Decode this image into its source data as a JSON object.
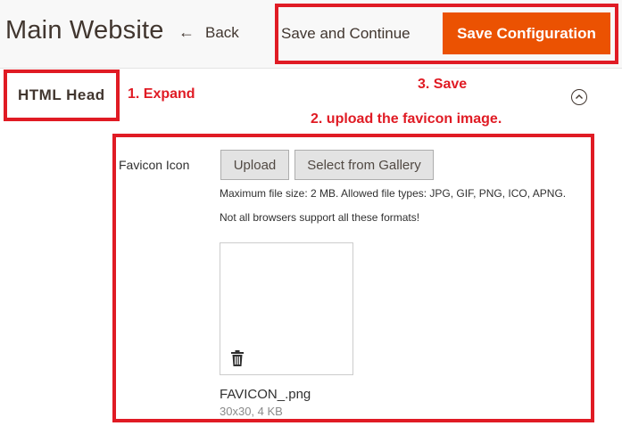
{
  "header": {
    "title": "Main Website",
    "back_label": "Back",
    "save_continue_label": "Save and Continue",
    "save_config_label": "Save Configuration"
  },
  "section": {
    "title": "HTML Head"
  },
  "annotations": {
    "expand": "1. Expand",
    "save": "3. Save",
    "upload": "2. upload the favicon image."
  },
  "favicon": {
    "label": "Favicon Icon",
    "upload_label": "Upload",
    "gallery_label": "Select from Gallery",
    "note_1": "Maximum file size: 2 MB. Allowed file types: JPG, GIF, PNG, ICO, APNG.",
    "note_2": "Not all browsers support all these formats!",
    "file_name": "FAVICON_.png",
    "file_meta": "30x30, 4 KB"
  },
  "icons": {
    "back": "arrow-left-icon",
    "collapse": "chevron-up-icon",
    "delete": "trash-icon"
  },
  "colors": {
    "accent": "#eb5202",
    "annotation": "#e01b24"
  }
}
